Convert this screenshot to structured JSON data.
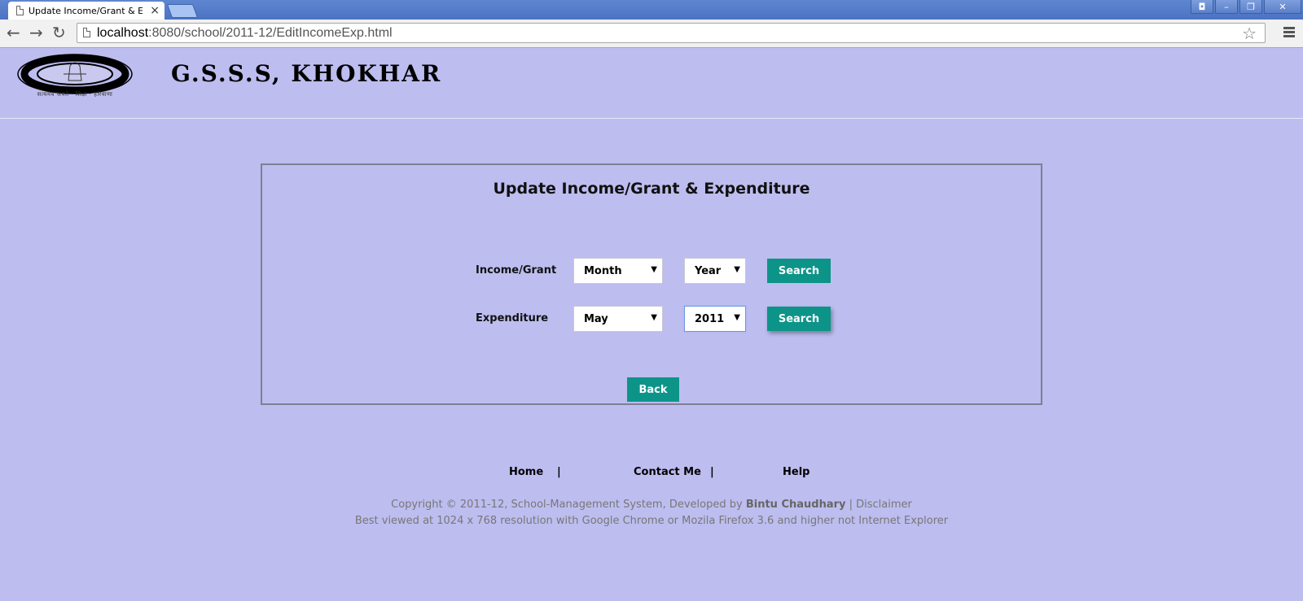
{
  "browser": {
    "tab_title": "Update Income/Grant & Expe",
    "url_host": "localhost",
    "url_rest": ":8080/school/2011-12/EditIncomeExp.html"
  },
  "header": {
    "site_title": "G.S.S.S, KHOKHAR",
    "logo_caption": "सत्यमेवं जयते · शिक्षा · हरियाणा"
  },
  "form": {
    "title": "Update Income/Grant & Expenditure",
    "rows": [
      {
        "label": "Income/Grant",
        "month": "Month",
        "year": "Year",
        "button": "Search"
      },
      {
        "label": "Expenditure",
        "month": "May",
        "year": "2011",
        "button": "Search"
      }
    ],
    "back_button": "Back"
  },
  "footer": {
    "links": [
      "Home",
      "Contact Me",
      "Help"
    ],
    "separator": "|",
    "copyright_prefix": "Copyright © 2011-12, School-Management System, Developed by ",
    "author": "Bintu Chaudhary",
    "copyright_suffix": " | Disclaimer",
    "best_viewed": "Best viewed at 1024 x 768 resolution with Google Chrome or Mozila Firefox 3.6 and higher not Internet Explorer"
  },
  "colors": {
    "page_bg": "#bdbdf0",
    "button_bg": "#0d9488"
  }
}
